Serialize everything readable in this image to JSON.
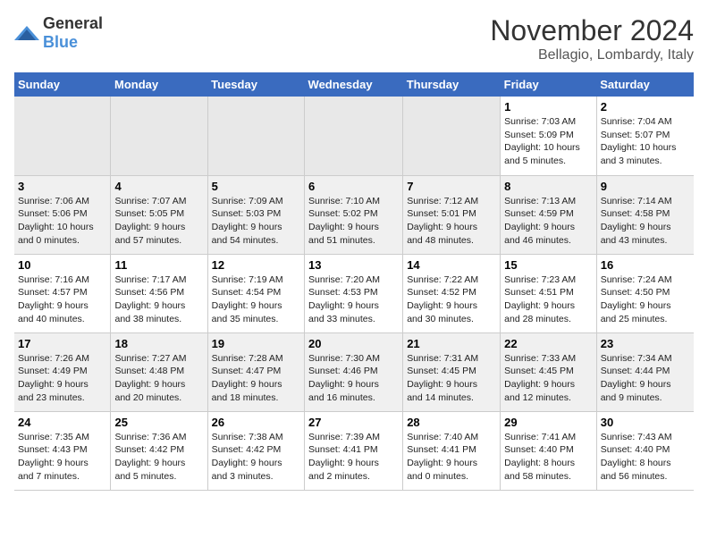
{
  "logo": {
    "text_general": "General",
    "text_blue": "Blue"
  },
  "title": "November 2024",
  "location": "Bellagio, Lombardy, Italy",
  "days_of_week": [
    "Sunday",
    "Monday",
    "Tuesday",
    "Wednesday",
    "Thursday",
    "Friday",
    "Saturday"
  ],
  "weeks": [
    [
      {
        "day": "",
        "info": ""
      },
      {
        "day": "",
        "info": ""
      },
      {
        "day": "",
        "info": ""
      },
      {
        "day": "",
        "info": ""
      },
      {
        "day": "",
        "info": ""
      },
      {
        "day": "1",
        "info": "Sunrise: 7:03 AM\nSunset: 5:09 PM\nDaylight: 10 hours\nand 5 minutes."
      },
      {
        "day": "2",
        "info": "Sunrise: 7:04 AM\nSunset: 5:07 PM\nDaylight: 10 hours\nand 3 minutes."
      }
    ],
    [
      {
        "day": "3",
        "info": "Sunrise: 7:06 AM\nSunset: 5:06 PM\nDaylight: 10 hours\nand 0 minutes."
      },
      {
        "day": "4",
        "info": "Sunrise: 7:07 AM\nSunset: 5:05 PM\nDaylight: 9 hours\nand 57 minutes."
      },
      {
        "day": "5",
        "info": "Sunrise: 7:09 AM\nSunset: 5:03 PM\nDaylight: 9 hours\nand 54 minutes."
      },
      {
        "day": "6",
        "info": "Sunrise: 7:10 AM\nSunset: 5:02 PM\nDaylight: 9 hours\nand 51 minutes."
      },
      {
        "day": "7",
        "info": "Sunrise: 7:12 AM\nSunset: 5:01 PM\nDaylight: 9 hours\nand 48 minutes."
      },
      {
        "day": "8",
        "info": "Sunrise: 7:13 AM\nSunset: 4:59 PM\nDaylight: 9 hours\nand 46 minutes."
      },
      {
        "day": "9",
        "info": "Sunrise: 7:14 AM\nSunset: 4:58 PM\nDaylight: 9 hours\nand 43 minutes."
      }
    ],
    [
      {
        "day": "10",
        "info": "Sunrise: 7:16 AM\nSunset: 4:57 PM\nDaylight: 9 hours\nand 40 minutes."
      },
      {
        "day": "11",
        "info": "Sunrise: 7:17 AM\nSunset: 4:56 PM\nDaylight: 9 hours\nand 38 minutes."
      },
      {
        "day": "12",
        "info": "Sunrise: 7:19 AM\nSunset: 4:54 PM\nDaylight: 9 hours\nand 35 minutes."
      },
      {
        "day": "13",
        "info": "Sunrise: 7:20 AM\nSunset: 4:53 PM\nDaylight: 9 hours\nand 33 minutes."
      },
      {
        "day": "14",
        "info": "Sunrise: 7:22 AM\nSunset: 4:52 PM\nDaylight: 9 hours\nand 30 minutes."
      },
      {
        "day": "15",
        "info": "Sunrise: 7:23 AM\nSunset: 4:51 PM\nDaylight: 9 hours\nand 28 minutes."
      },
      {
        "day": "16",
        "info": "Sunrise: 7:24 AM\nSunset: 4:50 PM\nDaylight: 9 hours\nand 25 minutes."
      }
    ],
    [
      {
        "day": "17",
        "info": "Sunrise: 7:26 AM\nSunset: 4:49 PM\nDaylight: 9 hours\nand 23 minutes."
      },
      {
        "day": "18",
        "info": "Sunrise: 7:27 AM\nSunset: 4:48 PM\nDaylight: 9 hours\nand 20 minutes."
      },
      {
        "day": "19",
        "info": "Sunrise: 7:28 AM\nSunset: 4:47 PM\nDaylight: 9 hours\nand 18 minutes."
      },
      {
        "day": "20",
        "info": "Sunrise: 7:30 AM\nSunset: 4:46 PM\nDaylight: 9 hours\nand 16 minutes."
      },
      {
        "day": "21",
        "info": "Sunrise: 7:31 AM\nSunset: 4:45 PM\nDaylight: 9 hours\nand 14 minutes."
      },
      {
        "day": "22",
        "info": "Sunrise: 7:33 AM\nSunset: 4:45 PM\nDaylight: 9 hours\nand 12 minutes."
      },
      {
        "day": "23",
        "info": "Sunrise: 7:34 AM\nSunset: 4:44 PM\nDaylight: 9 hours\nand 9 minutes."
      }
    ],
    [
      {
        "day": "24",
        "info": "Sunrise: 7:35 AM\nSunset: 4:43 PM\nDaylight: 9 hours\nand 7 minutes."
      },
      {
        "day": "25",
        "info": "Sunrise: 7:36 AM\nSunset: 4:42 PM\nDaylight: 9 hours\nand 5 minutes."
      },
      {
        "day": "26",
        "info": "Sunrise: 7:38 AM\nSunset: 4:42 PM\nDaylight: 9 hours\nand 3 minutes."
      },
      {
        "day": "27",
        "info": "Sunrise: 7:39 AM\nSunset: 4:41 PM\nDaylight: 9 hours\nand 2 minutes."
      },
      {
        "day": "28",
        "info": "Sunrise: 7:40 AM\nSunset: 4:41 PM\nDaylight: 9 hours\nand 0 minutes."
      },
      {
        "day": "29",
        "info": "Sunrise: 7:41 AM\nSunset: 4:40 PM\nDaylight: 8 hours\nand 58 minutes."
      },
      {
        "day": "30",
        "info": "Sunrise: 7:43 AM\nSunset: 4:40 PM\nDaylight: 8 hours\nand 56 minutes."
      }
    ]
  ]
}
